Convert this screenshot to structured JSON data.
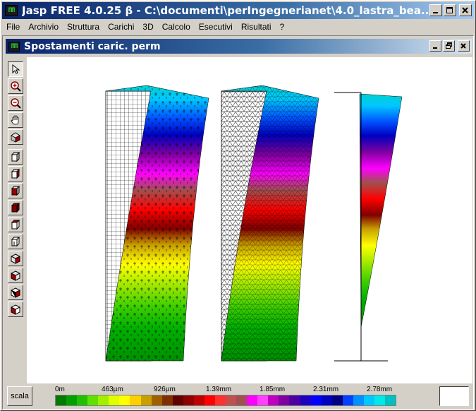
{
  "window": {
    "title": "Jasp FREE 4.0.25 β - C:\\documenti\\perIngegnerianet\\4.0_lastra_bea...",
    "icon": "app-logo-icon",
    "controls": [
      "minimize",
      "maximize",
      "close"
    ]
  },
  "menu": {
    "items": [
      "File",
      "Archivio",
      "Struttura",
      "Carichi",
      "3D",
      "Calcolo",
      "Esecutivi",
      "Risultati",
      "?"
    ]
  },
  "child_window": {
    "title": "Spostamenti caric. perm",
    "controls": [
      "minimize",
      "restore",
      "close"
    ]
  },
  "toolbar": {
    "tools": [
      "pointer-icon",
      "zoom-in-icon",
      "zoom-out-icon",
      "pan-hand-icon",
      "rotate-icon",
      "view-front-icon",
      "view-back-icon",
      "view-left-icon",
      "view-right-icon",
      "view-top-icon",
      "view-bottom-icon",
      "iso-1-icon",
      "iso-2-icon",
      "iso-3-icon",
      "iso-4-icon"
    ]
  },
  "legend": {
    "scala_label": "scala",
    "ticks": [
      "0m",
      "463µm",
      "926µm",
      "1.39mm",
      "1.85mm",
      "2.31mm",
      "2.78mm"
    ],
    "colors": [
      "#007a00",
      "#00a000",
      "#20c000",
      "#60e000",
      "#a0f000",
      "#e0ff00",
      "#ffff00",
      "#ffd000",
      "#c8a000",
      "#a06000",
      "#803000",
      "#600000",
      "#900000",
      "#c00000",
      "#ff0000",
      "#ff3030",
      "#c05050",
      "#a05050",
      "#ff00ff",
      "#ff40ff",
      "#c000c0",
      "#8000a0",
      "#5000a0",
      "#2000c0",
      "#0000ff",
      "#0000c0",
      "#000080",
      "#0040ff",
      "#0090ff",
      "#00c8ff",
      "#00e8e8",
      "#00c0c0"
    ]
  },
  "colors": {
    "title_active": "#0a246a",
    "face": "#d4d0c8"
  }
}
